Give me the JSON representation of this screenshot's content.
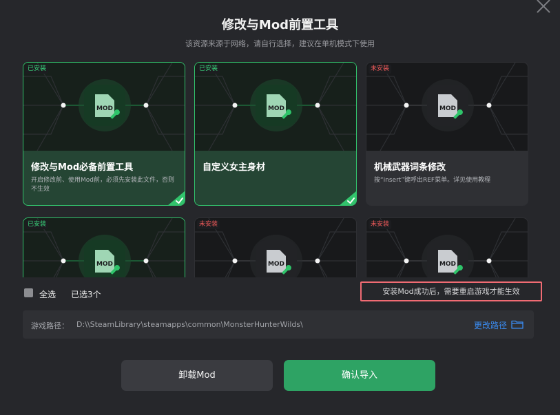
{
  "dialog": {
    "title": "修改与Mod前置工具",
    "subtitle": "该资源来源于网络，请自行选择，建议在单机模式下使用"
  },
  "cards": [
    {
      "badge": "已安装",
      "installed": true,
      "title": "修改与Mod必备前置工具",
      "desc": "开启修改前、使用Mod前，必须先安装此文件，否则不生效"
    },
    {
      "badge": "已安装",
      "installed": true,
      "title": "自定义女主身材",
      "desc": ""
    },
    {
      "badge": "未安装",
      "installed": false,
      "title": "机械武器词条修改",
      "desc": "按“insert”键呼出REF菜单。详见使用教程"
    },
    {
      "badge": "已安装",
      "installed": true,
      "title": "",
      "desc": ""
    },
    {
      "badge": "未安装",
      "installed": false,
      "title": "",
      "desc": ""
    },
    {
      "badge": "未安装",
      "installed": false,
      "title": "",
      "desc": ""
    }
  ],
  "footer": {
    "select_all": "全选",
    "selected_count": "已选3个",
    "notice": "安装Mod成功后，需要重启游戏才能生效"
  },
  "path": {
    "label": "游戏路径：",
    "value": "D:\\\\SteamLibrary\\steamapps\\common\\MonsterHunterWilds\\",
    "change": "更改路径"
  },
  "buttons": {
    "uninstall": "卸载Mod",
    "confirm": "确认导入"
  },
  "colors": {
    "accent_green": "#2ea364",
    "installed_badge": "#39d27a",
    "not_installed_badge": "#f05a5a",
    "notice_border": "#f06b73",
    "link_blue": "#3a8bf0"
  },
  "icons": {
    "close": "close-icon",
    "mod_file": "mod-file-icon",
    "wrench": "wrench-icon",
    "check": "check-icon",
    "folder": "folder-icon"
  }
}
